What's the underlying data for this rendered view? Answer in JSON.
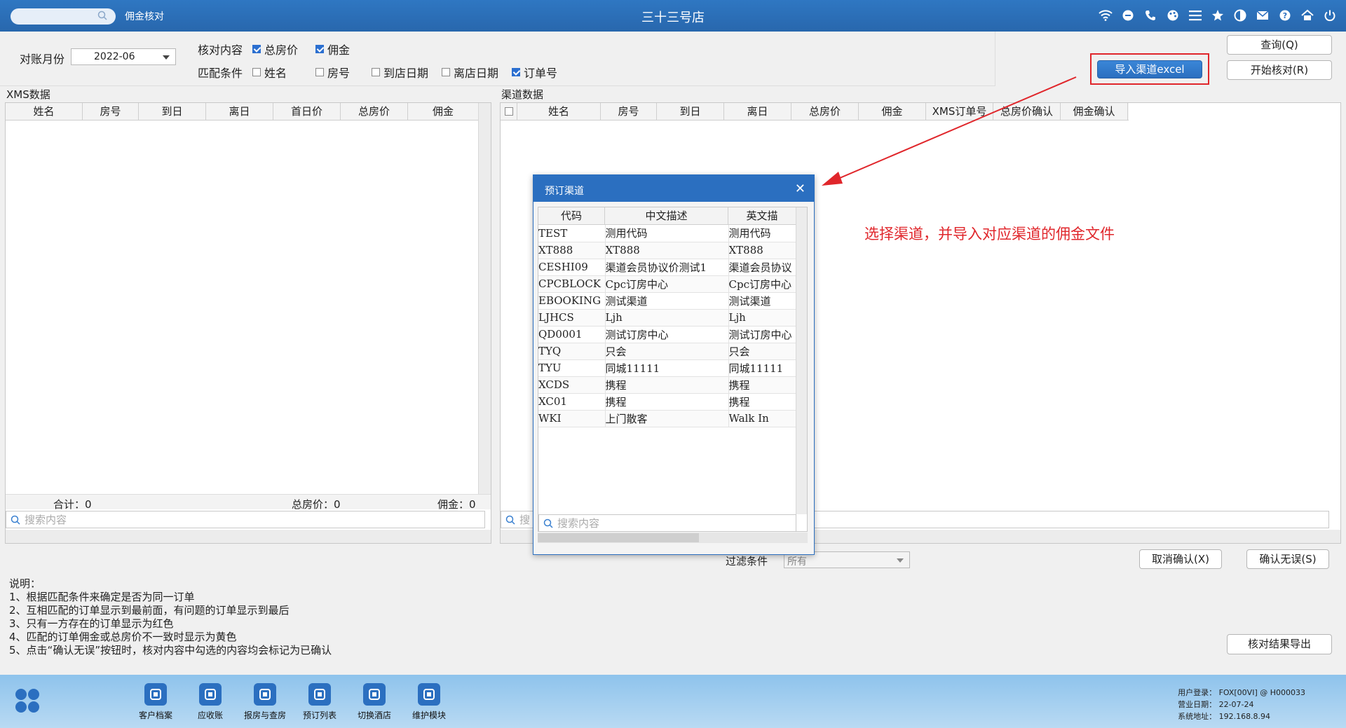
{
  "titlebar": {
    "module": "佣金核对",
    "store": "三十三号店"
  },
  "filters": {
    "month_label": "对账月份",
    "month_value": "2022-06",
    "check_label": "核对内容",
    "check_items": [
      {
        "label": "总房价",
        "checked": true
      },
      {
        "label": "佣金",
        "checked": true
      }
    ],
    "match_label": "匹配条件",
    "match_items": [
      {
        "label": "姓名",
        "checked": false
      },
      {
        "label": "房号",
        "checked": false
      },
      {
        "label": "到店日期",
        "checked": false
      },
      {
        "label": "离店日期",
        "checked": false
      },
      {
        "label": "订单号",
        "checked": true
      }
    ]
  },
  "buttons": {
    "import": "导入渠道excel",
    "query": "查询(Q)",
    "start": "开始核对(R)",
    "cancel_confirm": "取消确认(X)",
    "confirm_ok": "确认无误(S)",
    "export": "核对结果导出"
  },
  "xms": {
    "title": "XMS数据",
    "columns": [
      "姓名",
      "房号",
      "到日",
      "离日",
      "首日价",
      "总房价",
      "佣金"
    ],
    "total_label": "合计：0",
    "room_total_label": "总房价：0",
    "commission_label": "佣金：0",
    "search_placeholder": "搜索内容"
  },
  "channel": {
    "title": "渠道数据",
    "columns": [
      "姓名",
      "房号",
      "到日",
      "离日",
      "总房价",
      "佣金",
      "XMS订单号",
      "总房价确认",
      "佣金确认"
    ],
    "search_placeholder": "搜"
  },
  "annotation": "选择渠道，并导入对应渠道的佣金文件",
  "dialog": {
    "title": "预订渠道",
    "columns": [
      "代码",
      "中文描述",
      "英文描"
    ],
    "rows": [
      [
        "TEST",
        "测用代码",
        "测用代码"
      ],
      [
        "XT888",
        "XT888",
        "XT888"
      ],
      [
        "CESHI09",
        "渠道会员协议价测试1",
        "渠道会员协议"
      ],
      [
        "CPCBLOCK",
        "Cpc订房中心",
        "Cpc订房中心"
      ],
      [
        "EBOOKING",
        "测试渠道",
        "测试渠道"
      ],
      [
        "LJHCS",
        "Ljh",
        "Ljh"
      ],
      [
        "QD0001",
        "测试订房中心",
        "测试订房中心"
      ],
      [
        "TYQ",
        "只会",
        "只会"
      ],
      [
        "TYU",
        "同城11111",
        "同城11111"
      ],
      [
        "XCDS",
        "携程",
        "携程"
      ],
      [
        "XC01",
        "携程",
        "携程"
      ],
      [
        "WKI",
        "上门散客",
        "Walk In"
      ]
    ],
    "search_placeholder": "搜索内容"
  },
  "filter_bar": {
    "label": "过滤条件",
    "value": "所有"
  },
  "notes": [
    "说明：",
    "1、根据匹配条件来确定是否为同一订单",
    "2、互相匹配的订单显示到最前面，有问题的订单显示到最后",
    "3、只有一方存在的订单显示为红色",
    "4、匹配的订单佣金或总房价不一致时显示为黄色",
    "5、点击“确认无误”按钮时，核对内容中勾选的内容均会标记为已确认"
  ],
  "taskbar": [
    {
      "label": "客户档案",
      "icon": "customer-icon"
    },
    {
      "label": "应收账",
      "icon": "receivable-icon"
    },
    {
      "label": "报房与查房",
      "icon": "room-report-icon"
    },
    {
      "label": "预订列表",
      "icon": "booking-list-icon"
    },
    {
      "label": "切换酒店",
      "icon": "switch-hotel-icon"
    },
    {
      "label": "维护模块",
      "icon": "maintenance-icon"
    }
  ],
  "sysinfo": {
    "user": "用户登录： FOX[00VI] @ H000033",
    "date": "营业日期： 22-07-24",
    "ip": "系统地址： 192.168.8.94"
  },
  "colors": {
    "primary": "#2b6fc0",
    "annotation": "#e0262b"
  }
}
